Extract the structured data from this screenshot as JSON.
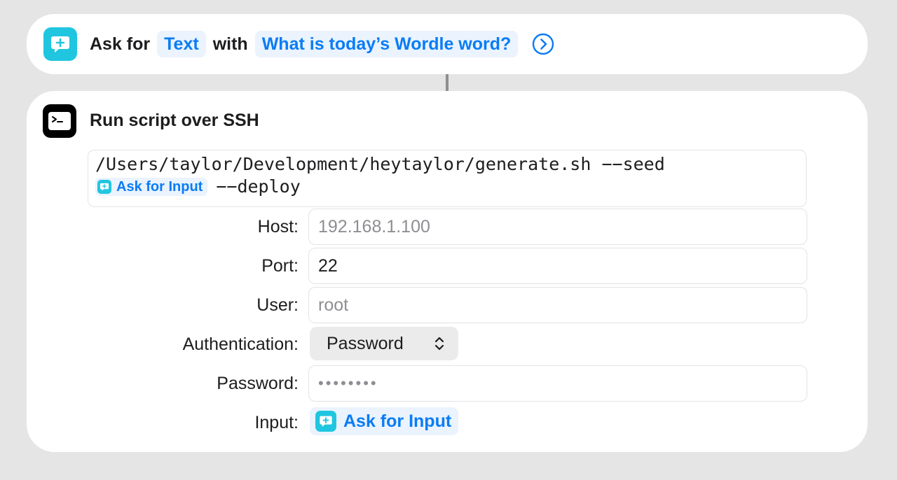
{
  "ask_action": {
    "icon": "ask-for-input-icon",
    "prefix": "Ask for",
    "type_token": "Text",
    "with_word": "with",
    "prompt_token": "What is today’s Wordle word?",
    "expand_icon": "chevron-right-circle-icon"
  },
  "ssh_action": {
    "icon": "terminal-icon",
    "title": "Run script over SSH",
    "script": {
      "line1": "/Users/taylor/Development/heytaylor/generate.sh −−seed",
      "token_label": "Ask for Input",
      "line2_suffix": "−−deploy"
    },
    "fields": {
      "host": {
        "label": "Host:",
        "placeholder": "192.168.1.100"
      },
      "port": {
        "label": "Port:",
        "value": "22"
      },
      "user": {
        "label": "User:",
        "placeholder": "root"
      },
      "authentication": {
        "label": "Authentication:",
        "value": "Password"
      },
      "password": {
        "label": "Password:",
        "value": "••••••••"
      },
      "input": {
        "label": "Input:",
        "token_label": "Ask for Input"
      }
    }
  },
  "colors": {
    "background": "#e5e5e5",
    "card": "#ffffff",
    "accent": "#0a7cf5",
    "token_bg": "#eaf3fe",
    "ask_icon": "#20c6e0",
    "terminal_icon": "#000000"
  }
}
